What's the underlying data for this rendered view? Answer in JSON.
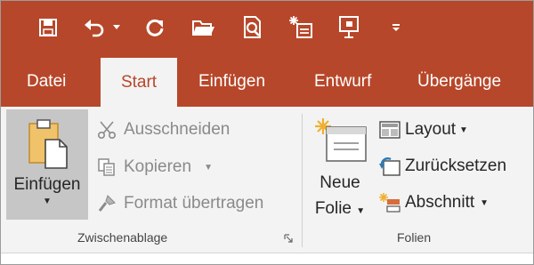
{
  "quick_access": {
    "icons": [
      "save-icon",
      "undo-icon",
      "undo-dropdown-icon",
      "redo-icon",
      "open-folder-icon",
      "print-preview-icon",
      "new-slide-icon",
      "presentation-icon",
      "customize-qat-icon"
    ]
  },
  "tabs": [
    {
      "label": "Datei"
    },
    {
      "label": "Start",
      "active": true
    },
    {
      "label": "Einfügen"
    },
    {
      "label": "Entwurf"
    },
    {
      "label": "Übergänge"
    }
  ],
  "clipboard": {
    "paste_label": "Einfügen",
    "cut_label": "Ausschneiden",
    "copy_label": "Kopieren",
    "format_painter_label": "Format übertragen",
    "group_label": "Zwischenablage"
  },
  "slides": {
    "new_slide_line1": "Neue",
    "new_slide_line2": "Folie",
    "layout_label": "Layout",
    "reset_label": "Zurücksetzen",
    "section_label": "Abschnitt",
    "group_label": "Folien"
  },
  "colors": {
    "accent": "#b7472a",
    "ribbon_bg": "#f3f3f3",
    "disabled_text": "#8a8a8a"
  }
}
